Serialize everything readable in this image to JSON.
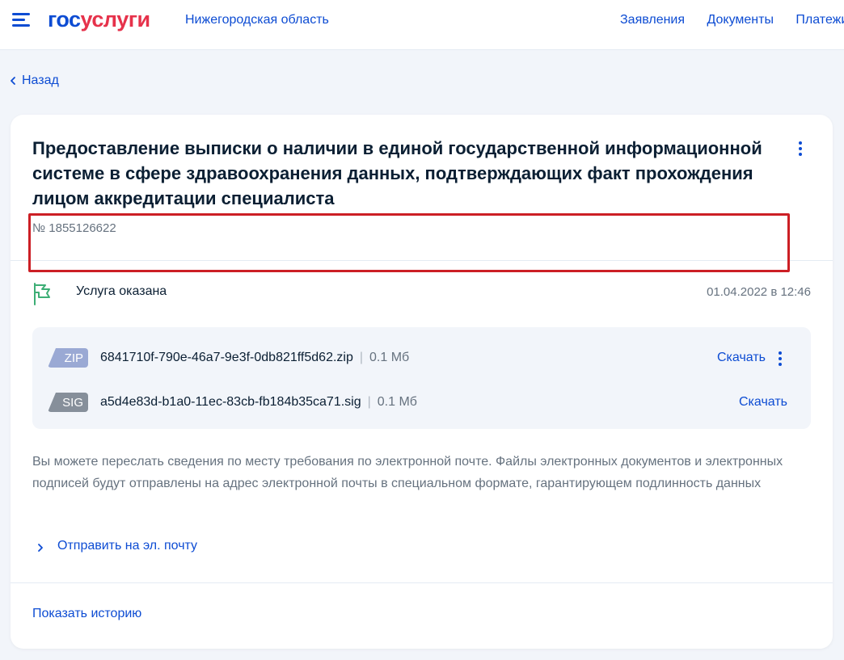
{
  "header": {
    "logo_part1": "гос",
    "logo_part2": "услуги",
    "region": "Нижегородская область",
    "nav": [
      "Заявления",
      "Документы",
      "Платежи"
    ],
    "colors": {
      "brand_blue": "#0d4cd3",
      "brand_red": "#e6324b"
    }
  },
  "back_label": "Назад",
  "card": {
    "title": "Предоставление выписки о наличии в единой государственной информационной системе в сфере здравоохранения данных, подтверждающих факт прохождения лицом аккредитации специалиста",
    "number": "№ 1855126622",
    "status": {
      "icon": "flag-icon",
      "label": "Услуга оказана",
      "date": "01.04.2022 в 12:46"
    },
    "files": [
      {
        "type": "ZIP",
        "name": "6841710f-790e-46a7-9e3f-0db821ff5d62.zip",
        "separator": "|",
        "size": "0.1 Мб",
        "action": "Скачать"
      },
      {
        "type": "SIG",
        "name": "a5d4e83d-b1a0-11ec-83cb-fb184b35ca71.sig",
        "separator": "|",
        "size": "0.1 Мб",
        "action": "Скачать"
      }
    ],
    "info_text": "Вы можете переслать сведения по месту требования по электронной почте. Файлы электронных документов и электронных подписей будут отправлены на адрес электронной почты в специальном формате, гарантирующем подлинность данных",
    "send_email": "Отправить на эл. почту",
    "show_history": "Показать историю"
  },
  "highlight_color": "#cc1f25"
}
